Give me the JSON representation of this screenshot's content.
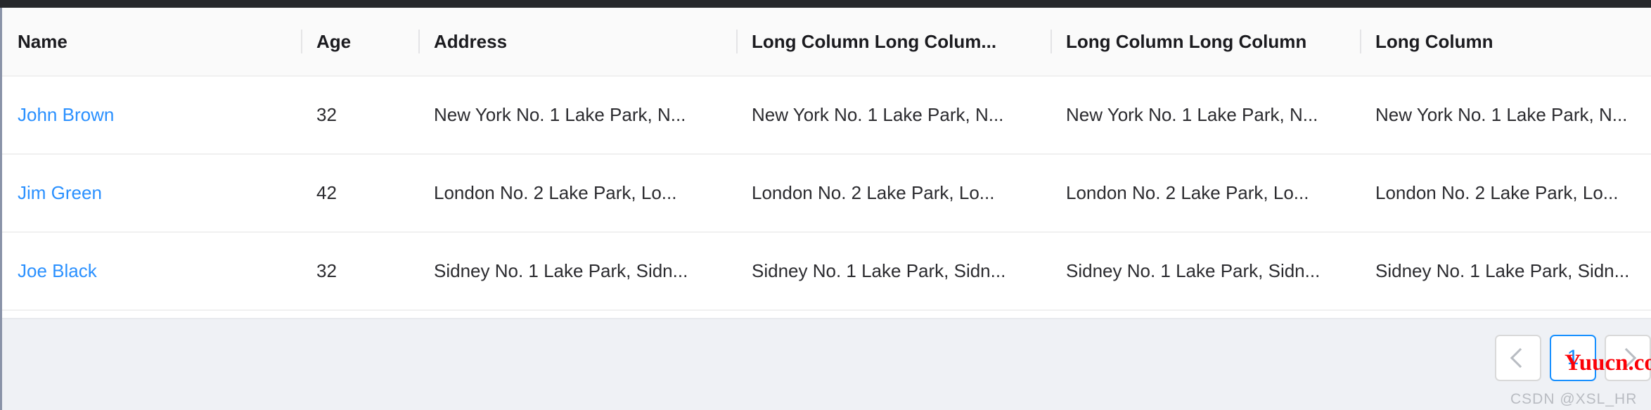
{
  "table": {
    "columns": [
      {
        "key": "name",
        "label": "Name"
      },
      {
        "key": "age",
        "label": "Age"
      },
      {
        "key": "address",
        "label": "Address"
      },
      {
        "key": "long1",
        "label": "Long Column Long Colum..."
      },
      {
        "key": "long2",
        "label": "Long Column Long Column"
      },
      {
        "key": "long3",
        "label": "Long Column"
      }
    ],
    "rows": [
      {
        "name": "John Brown",
        "age": "32",
        "address": "New York No. 1 Lake Park, N...",
        "long1": "New York No. 1 Lake Park, N...",
        "long2": "New York No. 1 Lake Park, N...",
        "long3": "New York No. 1 Lake Park, N..."
      },
      {
        "name": "Jim Green",
        "age": "42",
        "address": "London No. 2 Lake Park, Lo...",
        "long1": "London No. 2 Lake Park, Lo...",
        "long2": "London No. 2 Lake Park, Lo...",
        "long3": "London No. 2 Lake Park, Lo..."
      },
      {
        "name": "Joe Black",
        "age": "32",
        "address": "Sidney No. 1 Lake Park, Sidn...",
        "long1": "Sidney No. 1 Lake Park, Sidn...",
        "long2": "Sidney No. 1 Lake Park, Sidn...",
        "long3": "Sidney No. 1 Lake Park, Sidn..."
      }
    ]
  },
  "pagination": {
    "prev_icon": "chevron-left-icon",
    "next_icon": "chevron-right-icon",
    "current_page": "1"
  },
  "watermarks": {
    "site": "Yuucn.com",
    "credit": "CSDN @XSL_HR"
  },
  "colors": {
    "link": "#2a90ff",
    "accent": "#1890ff",
    "header_bg": "#fafafa",
    "footer_bg": "#eff1f5",
    "border": "#f0f0f0",
    "top_bar": "#26282b",
    "watermark_red": "#fb0007",
    "watermark_gray": "#b9bcc2"
  }
}
